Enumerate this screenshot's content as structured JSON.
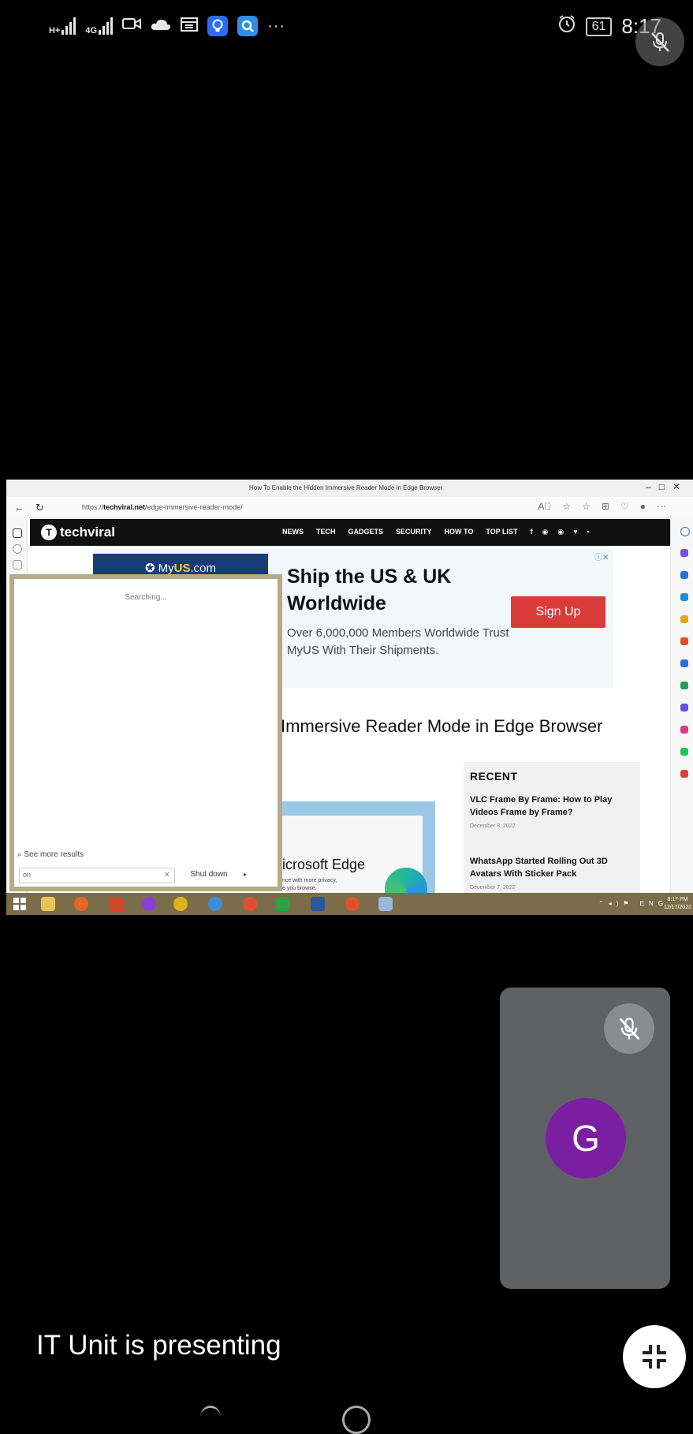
{
  "status_bar": {
    "network_1_type": "H+",
    "network_2_type": "4G",
    "more_indicator": "···",
    "battery": "61",
    "time": "8:17"
  },
  "shared_screen": {
    "tab_title": "How To Enable the Hidden Immersive Reader Mode in Edge Browser",
    "url_prefix": "https://",
    "url_domain": "techviral.net",
    "url_path": "/edge-immersive-reader-mode/",
    "site": {
      "logo": "techviral",
      "nav": [
        "NEWS",
        "TECH",
        "GADGETS",
        "SECURITY",
        "HOW TO",
        "TOP LIST"
      ]
    },
    "ad": {
      "brand_main": "My",
      "brand_accent": "US",
      "brand_suffix": ".com",
      "headline": "Ship the US & UK Worldwide",
      "body": "Over 6,000,000 Members Worldwide Trust MyUS With Their Shipments.",
      "button": "Sign Up"
    },
    "article": {
      "heading": "Immersive Reader Mode in Edge Browser",
      "image_title": "icrosoft Edge",
      "image_subtitle_1": "nce with more privacy,",
      "image_subtitle_2": "e you browse."
    },
    "recent": {
      "title": "RECENT",
      "items": [
        {
          "title": "VLC Frame By Frame: How to Play Videos Frame by Frame?",
          "date": "December 8, 2022"
        },
        {
          "title": "WhatsApp Started Rolling Out 3D Avatars With Sticker Pack",
          "date": "December 7, 2022"
        }
      ]
    },
    "search_popup": {
      "status": "Searching...",
      "see_more": "See more results",
      "query": "on",
      "shutdown": "Shut down"
    },
    "taskbar": {
      "lang": "ENG",
      "time": "8:17 PM",
      "date": "12/17/2022"
    }
  },
  "participant": {
    "initial": "G",
    "avatar_color": "#7a1fa2"
  },
  "presenting_label": "IT Unit is presenting"
}
